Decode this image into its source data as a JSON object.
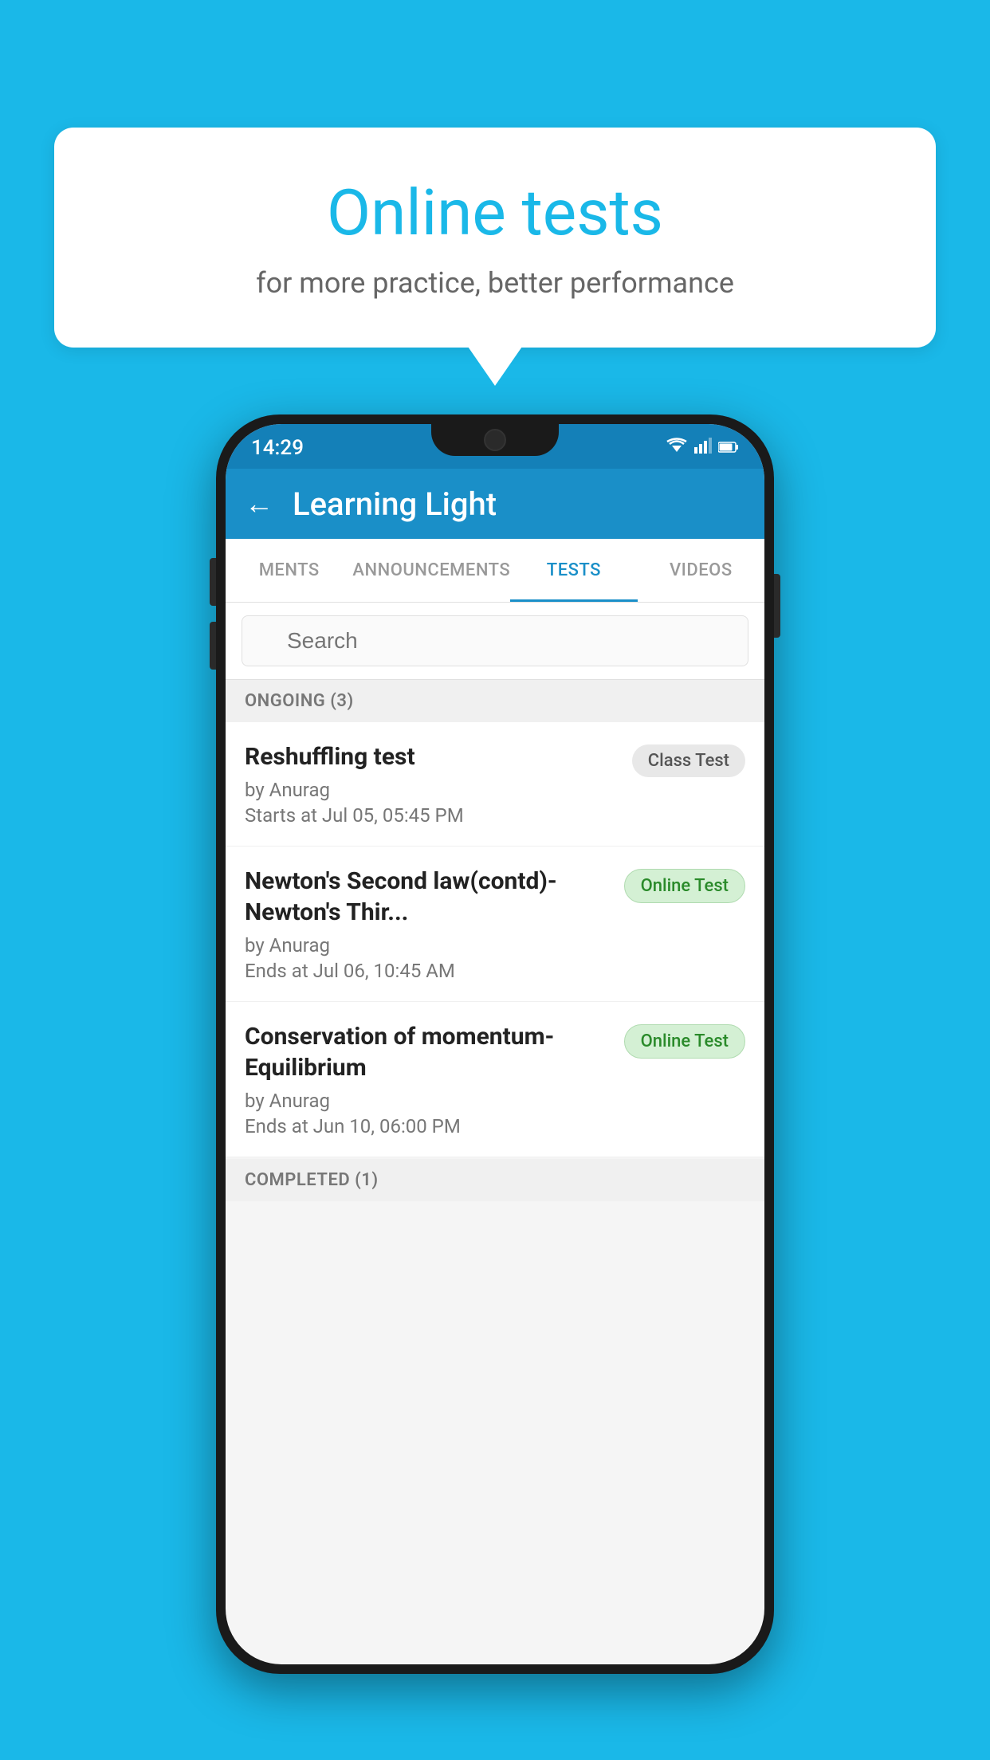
{
  "background_color": "#1ab8e8",
  "speech_bubble": {
    "title": "Online tests",
    "subtitle": "for more practice, better performance"
  },
  "phone": {
    "status_bar": {
      "time": "14:29",
      "icons": [
        "wifi",
        "signal",
        "battery"
      ]
    },
    "header": {
      "back_label": "←",
      "title": "Learning Light"
    },
    "tabs": [
      {
        "label": "MENTS",
        "active": false
      },
      {
        "label": "ANNOUNCEMENTS",
        "active": false
      },
      {
        "label": "TESTS",
        "active": true
      },
      {
        "label": "VIDEOS",
        "active": false
      }
    ],
    "search": {
      "placeholder": "Search"
    },
    "sections": [
      {
        "header": "ONGOING (3)",
        "tests": [
          {
            "name": "Reshuffling test",
            "author": "by Anurag",
            "time": "Starts at  Jul 05, 05:45 PM",
            "badge": "Class Test",
            "badge_type": "class"
          },
          {
            "name": "Newton's Second law(contd)-Newton's Thir...",
            "author": "by Anurag",
            "time": "Ends at  Jul 06, 10:45 AM",
            "badge": "Online Test",
            "badge_type": "online"
          },
          {
            "name": "Conservation of momentum-Equilibrium",
            "author": "by Anurag",
            "time": "Ends at  Jun 10, 06:00 PM",
            "badge": "Online Test",
            "badge_type": "online"
          }
        ]
      }
    ],
    "completed_section": "COMPLETED (1)"
  }
}
